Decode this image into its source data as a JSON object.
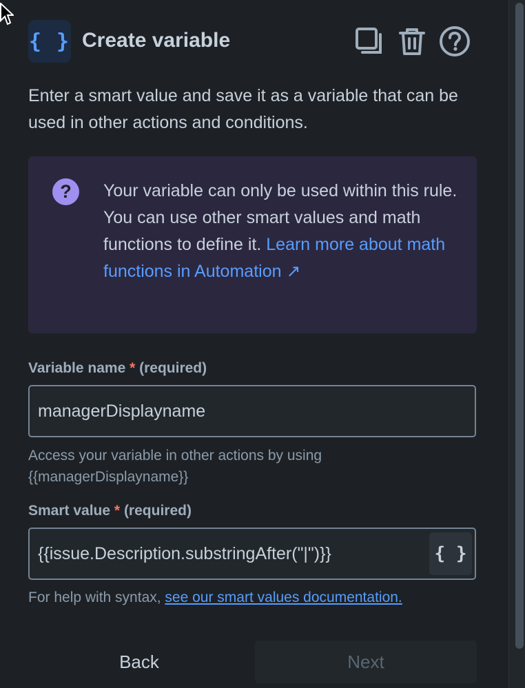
{
  "header": {
    "icon_glyph": "{ }",
    "title": "Create variable",
    "actions": [
      {
        "name": "copy-icon"
      },
      {
        "name": "trash-icon"
      },
      {
        "name": "help-icon"
      }
    ]
  },
  "description": "Enter a smart value and save it as a variable that can be used in other actions and conditions.",
  "info": {
    "icon": "question-icon",
    "text": "Your variable can only be used within this rule. You can use other smart values and math functions to define it. ",
    "link_text": "Learn more about math functions in Automation",
    "link_arrow": "↗"
  },
  "variable_name": {
    "label": "Variable name",
    "required_star": "*",
    "required_text": "(required)",
    "value": "managerDisplayname",
    "helper_line1": "Access your variable in other actions by using",
    "helper_line2": "{{managerDisplayname}}"
  },
  "smart_value": {
    "label": "Smart value",
    "required_star": "*",
    "required_text": "(required)",
    "value": "{{issue.Description.substringAfter(\"|\")}}",
    "picker_glyph": "{ }",
    "helper_prefix": "For help with syntax, ",
    "helper_link": "see our smart values documentation."
  },
  "footer": {
    "back_label": "Back",
    "next_label": "Next"
  },
  "colors": {
    "background": "#1d2125",
    "accent": "#579dff",
    "info_background": "#2b273f",
    "info_icon": "#9f8fef",
    "required": "#f87462"
  }
}
